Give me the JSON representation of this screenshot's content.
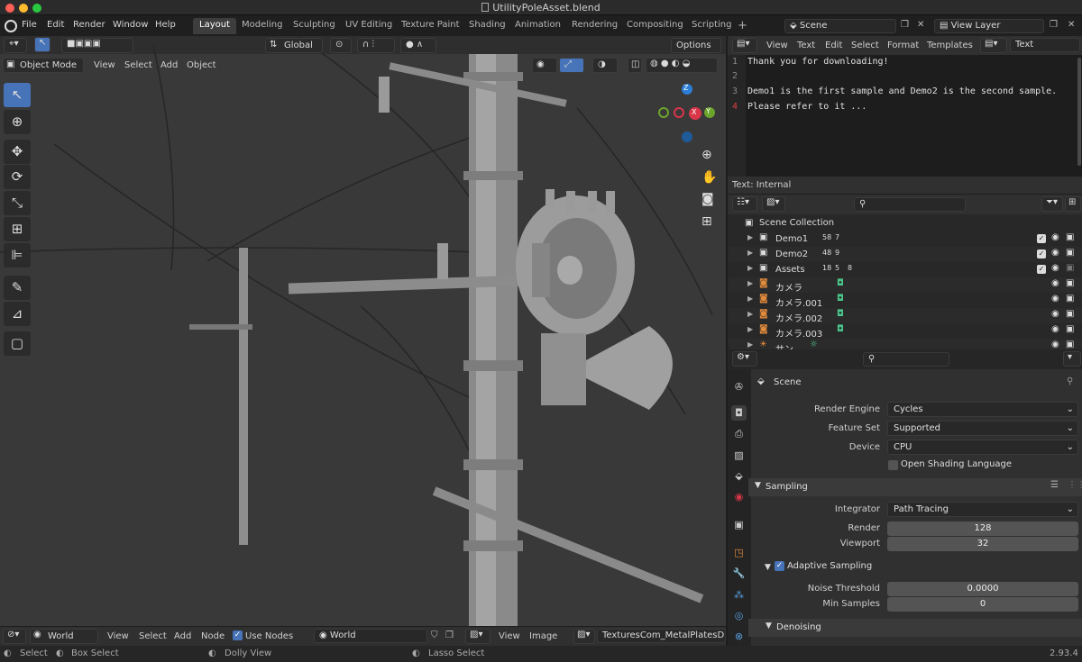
{
  "window": {
    "title": "UtilityPoleAsset.blend"
  },
  "menu": [
    "File",
    "Edit",
    "Render",
    "Window",
    "Help"
  ],
  "workspaces": [
    "Layout",
    "Modeling",
    "Sculpting",
    "UV Editing",
    "Texture Paint",
    "Shading",
    "Animation",
    "Rendering",
    "Compositing",
    "Scripting"
  ],
  "scene_field": "Scene",
  "view_layer_field": "View Layer",
  "viewport": {
    "transform": "Global",
    "options": "Options",
    "mode": "Object Mode",
    "menus": [
      "View",
      "Select",
      "Add",
      "Object"
    ]
  },
  "text_editor": {
    "menus": [
      "View",
      "Text",
      "Edit",
      "Select",
      "Format",
      "Templates"
    ],
    "datablock": "Text",
    "line_numbers": [
      "1",
      "2",
      "3",
      "4"
    ],
    "lines": [
      "Thank you for downloading!",
      "",
      "Demo1 is the first sample and Demo2 is the second sample.",
      "Please refer to it ..."
    ],
    "footer": "Text: Internal"
  },
  "outliner": {
    "root": "Scene Collection",
    "items": [
      {
        "name": "Demo1",
        "badges": [
          "58",
          "7"
        ]
      },
      {
        "name": "Demo2",
        "badges": [
          "48",
          "9"
        ]
      },
      {
        "name": "Assets",
        "badges": [
          "18",
          "5",
          "8"
        ]
      },
      {
        "name": "カメラ",
        "badges": []
      },
      {
        "name": "カメラ.001",
        "badges": []
      },
      {
        "name": "カメラ.002",
        "badges": []
      },
      {
        "name": "カメラ.003",
        "badges": []
      },
      {
        "name": "サン",
        "badges": []
      }
    ]
  },
  "properties": {
    "context": "Scene",
    "render_engine": {
      "label": "Render Engine",
      "value": "Cycles"
    },
    "feature_set": {
      "label": "Feature Set",
      "value": "Supported"
    },
    "device": {
      "label": "Device",
      "value": "CPU"
    },
    "osl": "Open Shading Language",
    "sampling": "Sampling",
    "integrator": {
      "label": "Integrator",
      "value": "Path Tracing"
    },
    "render": {
      "label": "Render",
      "value": "128"
    },
    "viewport": {
      "label": "Viewport",
      "value": "32"
    },
    "adaptive": "Adaptive Sampling",
    "noise": {
      "label": "Noise Threshold",
      "value": "0.0000"
    },
    "min_samples": {
      "label": "Min Samples",
      "value": "0"
    },
    "denoising": "Denoising"
  },
  "node_editor": {
    "world": "World",
    "menus": [
      "View",
      "Select",
      "Add",
      "Node"
    ],
    "use_nodes": "Use Nodes",
    "world_field": "World"
  },
  "image_editor": {
    "menus": [
      "View",
      "Image"
    ],
    "image": "TexturesCom_MetalPlatesDucts"
  },
  "status": {
    "select": "Select",
    "box": "Box Select",
    "dolly": "Dolly View",
    "lasso": "Lasso Select",
    "version": "2.93.4"
  },
  "colors": {
    "accent": "#4773b8",
    "active_tab": "#3d3d3d",
    "panel": "#303030"
  }
}
